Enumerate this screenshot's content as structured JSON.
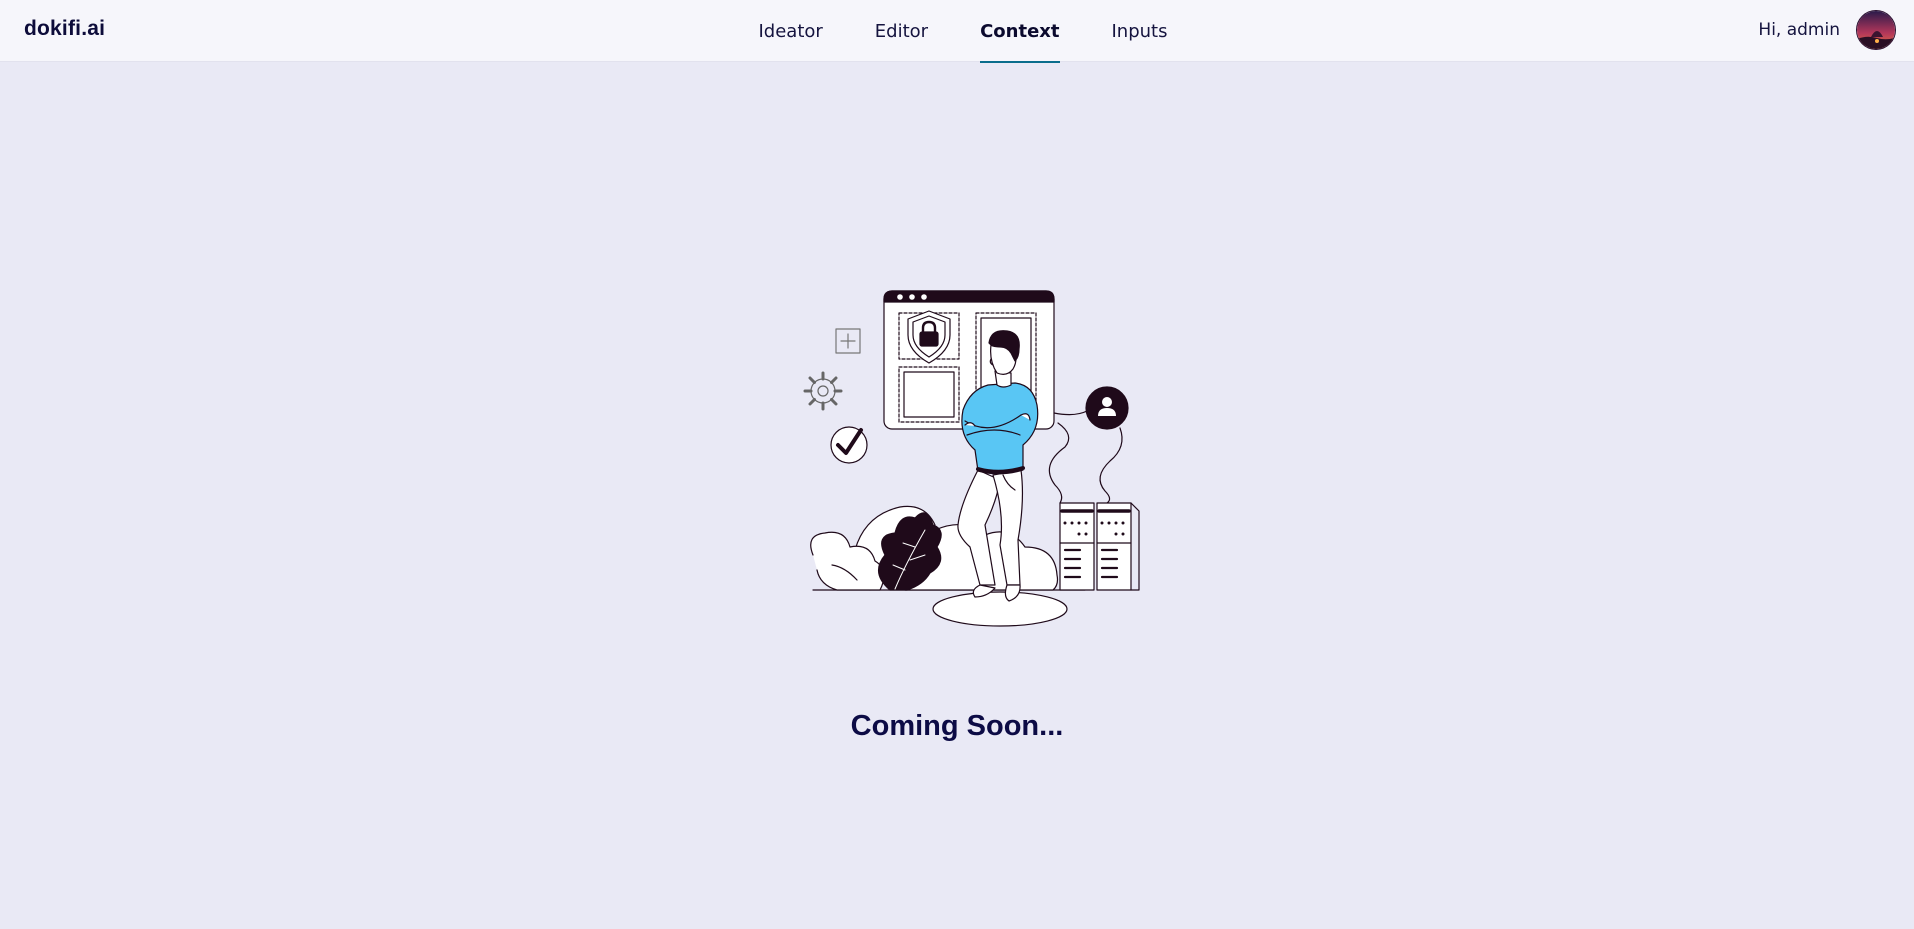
{
  "app": {
    "brand": "dokifi.ai"
  },
  "nav": {
    "tabs": [
      {
        "label": "Ideator",
        "active": false
      },
      {
        "label": "Editor",
        "active": false
      },
      {
        "label": "Context",
        "active": true
      },
      {
        "label": "Inputs",
        "active": false
      }
    ]
  },
  "user": {
    "greeting": "Hi, admin",
    "avatar_icon": "avatar-image"
  },
  "main": {
    "illustration_icon": "coming-soon-illustration",
    "message": "Coming Soon..."
  },
  "colors": {
    "background": "#e9e9f5",
    "header": "#f6f6fb",
    "active_tab_underline": "#0a6d8c",
    "text_dark": "#0c0b45",
    "sweater": "#59c6f4",
    "accent_dark": "#1f0a1a"
  }
}
